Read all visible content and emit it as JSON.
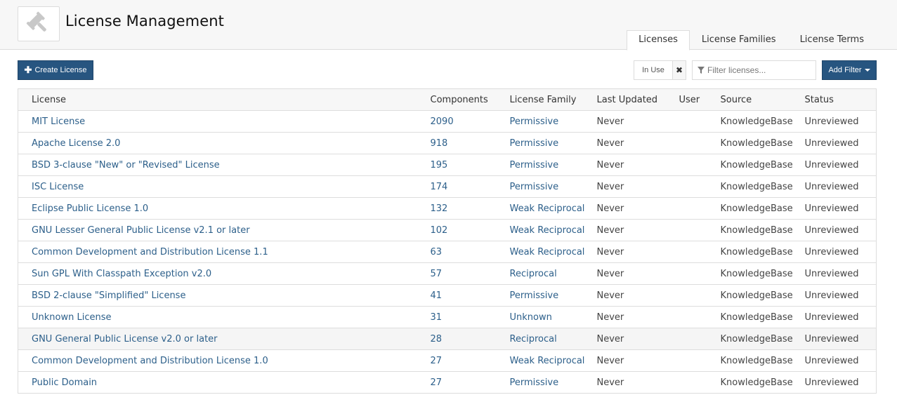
{
  "header": {
    "title": "License Management",
    "logo_icon": "gavel-icon",
    "tabs": [
      {
        "label": "Licenses",
        "active": true
      },
      {
        "label": "License Families",
        "active": false
      },
      {
        "label": "License Terms",
        "active": false
      }
    ]
  },
  "toolbar": {
    "create_label": "Create License",
    "create_icon": "plus-icon",
    "active_filter_chip": "In Use",
    "remove_filter_icon": "close-icon",
    "filter_placeholder": "Filter licenses...",
    "filter_value": "",
    "add_filter_label": "Add Filter"
  },
  "colors": {
    "primary_button": "#275580",
    "link": "#2c5f8a",
    "header_bg": "#f7f7f7",
    "row_hover": "#f5f5f5"
  },
  "table": {
    "columns": [
      "License",
      "Components",
      "License Family",
      "Last Updated",
      "User",
      "Source",
      "Status"
    ],
    "rows": [
      {
        "license": "MIT License",
        "components": "2090",
        "family": "Permissive",
        "updated": "Never",
        "user": "",
        "source": "KnowledgeBase",
        "status": "Unreviewed"
      },
      {
        "license": "Apache License 2.0",
        "components": "918",
        "family": "Permissive",
        "updated": "Never",
        "user": "",
        "source": "KnowledgeBase",
        "status": "Unreviewed"
      },
      {
        "license": "BSD 3-clause \"New\" or \"Revised\" License",
        "components": "195",
        "family": "Permissive",
        "updated": "Never",
        "user": "",
        "source": "KnowledgeBase",
        "status": "Unreviewed"
      },
      {
        "license": "ISC License",
        "components": "174",
        "family": "Permissive",
        "updated": "Never",
        "user": "",
        "source": "KnowledgeBase",
        "status": "Unreviewed"
      },
      {
        "license": "Eclipse Public License 1.0",
        "components": "132",
        "family": "Weak Reciprocal",
        "updated": "Never",
        "user": "",
        "source": "KnowledgeBase",
        "status": "Unreviewed"
      },
      {
        "license": "GNU Lesser General Public License v2.1 or later",
        "components": "102",
        "family": "Weak Reciprocal",
        "updated": "Never",
        "user": "",
        "source": "KnowledgeBase",
        "status": "Unreviewed"
      },
      {
        "license": "Common Development and Distribution License 1.1",
        "components": "63",
        "family": "Weak Reciprocal",
        "updated": "Never",
        "user": "",
        "source": "KnowledgeBase",
        "status": "Unreviewed"
      },
      {
        "license": "Sun GPL With Classpath Exception v2.0",
        "components": "57",
        "family": "Reciprocal",
        "updated": "Never",
        "user": "",
        "source": "KnowledgeBase",
        "status": "Unreviewed"
      },
      {
        "license": "BSD 2-clause \"Simplified\" License",
        "components": "41",
        "family": "Permissive",
        "updated": "Never",
        "user": "",
        "source": "KnowledgeBase",
        "status": "Unreviewed"
      },
      {
        "license": "Unknown License",
        "components": "31",
        "family": "Unknown",
        "updated": "Never",
        "user": "",
        "source": "KnowledgeBase",
        "status": "Unreviewed"
      },
      {
        "license": "GNU General Public License v2.0 or later",
        "components": "28",
        "family": "Reciprocal",
        "updated": "Never",
        "user": "",
        "source": "KnowledgeBase",
        "status": "Unreviewed",
        "hovered": true
      },
      {
        "license": "Common Development and Distribution License 1.0",
        "components": "27",
        "family": "Weak Reciprocal",
        "updated": "Never",
        "user": "",
        "source": "KnowledgeBase",
        "status": "Unreviewed"
      },
      {
        "license": "Public Domain",
        "components": "27",
        "family": "Permissive",
        "updated": "Never",
        "user": "",
        "source": "KnowledgeBase",
        "status": "Unreviewed"
      }
    ]
  }
}
